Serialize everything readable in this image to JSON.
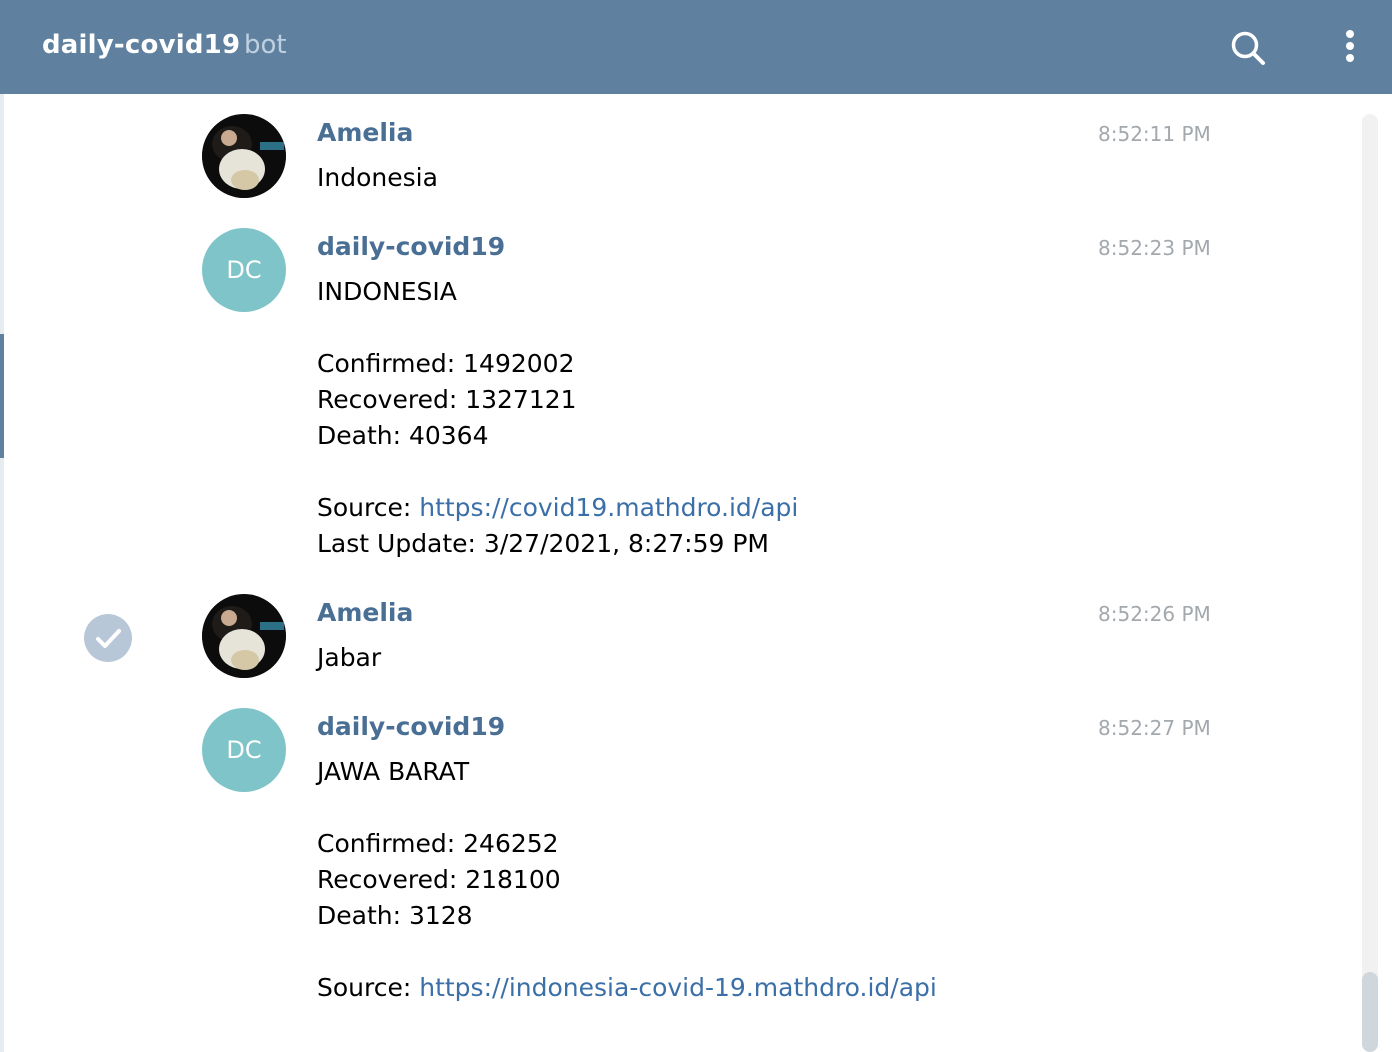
{
  "header": {
    "title": "daily-covid19",
    "subtitle": "bot",
    "search_icon": "search-icon",
    "menu_icon": "more-vertical-icon"
  },
  "messages": [
    {
      "sender": "Amelia",
      "time": "8:52:11 PM",
      "avatar": "photo",
      "lines": [
        "Indonesia"
      ]
    },
    {
      "sender": "daily-covid19",
      "time": "8:52:23 PM",
      "avatar_initials": "DC",
      "lines": [
        "INDONESIA",
        "",
        "Confirmed: 1492002",
        "Recovered: 1327121",
        "Death: 40364",
        ""
      ],
      "source_label": "Source: ",
      "source_link": "https://covid19.mathdro.id/api",
      "last_update": "Last Update: 3/27/2021, 8:27:59 PM"
    },
    {
      "sender": "Amelia",
      "time": "8:52:26 PM",
      "avatar": "photo",
      "lines": [
        "Jabar"
      ],
      "selected": true
    },
    {
      "sender": "daily-covid19",
      "time": "8:52:27 PM",
      "avatar_initials": "DC",
      "lines": [
        "JAWA BARAT",
        "",
        "Confirmed: 246252",
        "Recovered: 218100",
        "Death: 3128",
        ""
      ],
      "source_label": "Source: ",
      "source_link": "https://indonesia-covid-19.mathdro.id/api"
    }
  ]
}
